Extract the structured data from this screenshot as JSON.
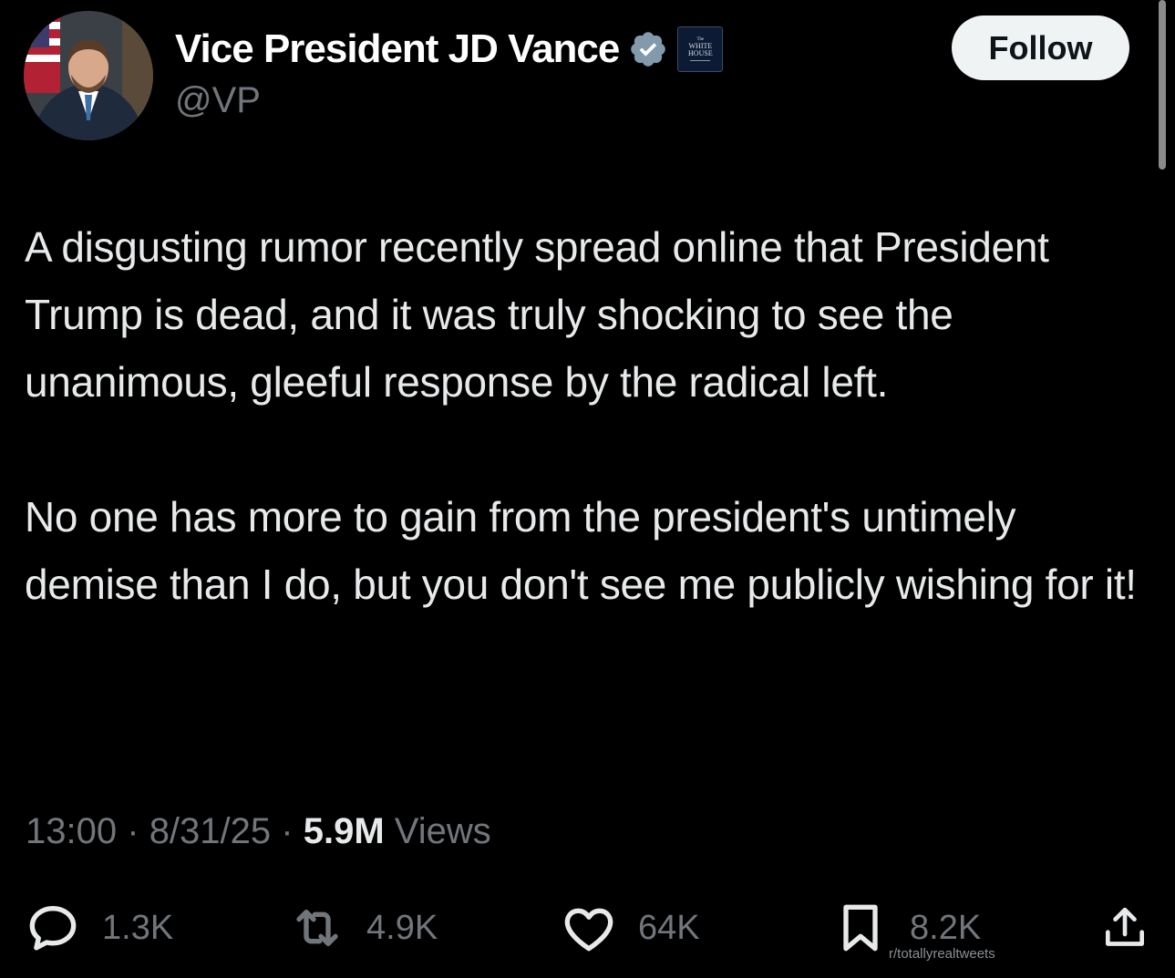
{
  "author": {
    "display_name": "Vice President JD Vance",
    "handle": "@VP",
    "affiliate_badge_line1": "The",
    "affiliate_badge_line2": "WHITE",
    "affiliate_badge_line3": "HOUSE"
  },
  "follow_button": {
    "label": "Follow"
  },
  "tweet": {
    "paragraphs": [
      "A disgusting rumor recently spread online that President Trump is dead, and it was truly shocking to see the unanimous, gleeful response by the radical left.",
      "No one has more to gain from the president's untimely demise than I do, but you don't see me publicly wishing for it!"
    ]
  },
  "meta": {
    "time": "13:00",
    "separator": "·",
    "date": "8/31/25",
    "views_count": "5.9M",
    "views_label": "Views"
  },
  "actions": {
    "replies": "1.3K",
    "reposts": "4.9K",
    "likes": "64K",
    "bookmarks": "8.2K"
  },
  "watermark": "r/totallyrealtweets",
  "colors": {
    "background": "#000000",
    "text": "#e7e9ea",
    "muted": "#71767b",
    "verified_badge": "#829aab",
    "follow_button_bg": "#eff3f4"
  },
  "icons": {
    "reply": "speech-bubble-icon",
    "repost": "repost-arrows-icon",
    "like": "heart-icon",
    "bookmark": "bookmark-icon",
    "share": "share-upload-icon",
    "verified": "verified-badge-icon"
  }
}
